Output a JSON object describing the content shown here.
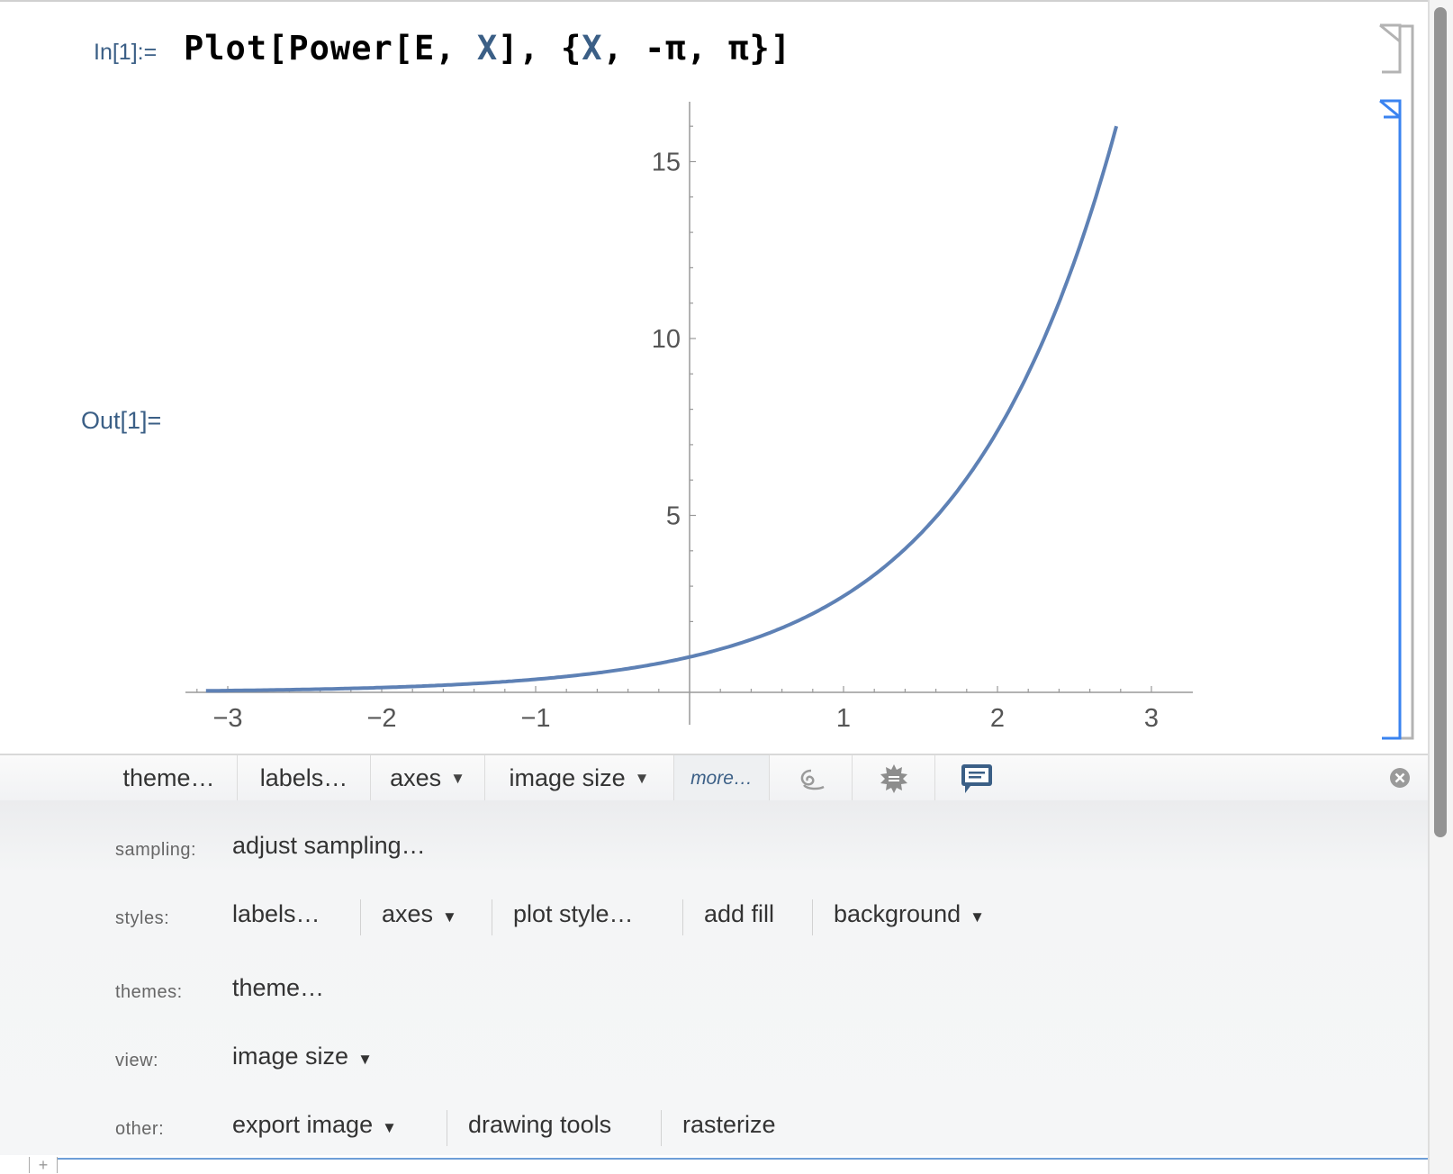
{
  "cell": {
    "in_label": "In[1]:=",
    "code_parts": [
      "Plot[Power[E, ",
      "X",
      "], {",
      "X",
      ", -π, π}]"
    ],
    "out_label": "Out[1]="
  },
  "chart_data": {
    "type": "line",
    "function": "e^x",
    "xlim": [
      -3.14159,
      3.14159
    ],
    "plot_range_y": [
      0,
      16
    ],
    "x_ticks": [
      -3,
      -2,
      -1,
      1,
      2,
      3
    ],
    "x_tick_labels": [
      "−3",
      "−2",
      "−1",
      "1",
      "2",
      "3"
    ],
    "y_ticks": [
      5,
      10,
      15
    ],
    "y_tick_labels": [
      "5",
      "10",
      "15"
    ],
    "line_color": "#5e81b5",
    "grid": false,
    "title": "",
    "xlabel": "",
    "ylabel": ""
  },
  "toolbar": {
    "items": [
      {
        "label": "theme…",
        "dropdown": false
      },
      {
        "label": "labels…",
        "dropdown": false
      },
      {
        "label": "axes",
        "dropdown": true
      },
      {
        "label": "image size",
        "dropdown": true
      },
      {
        "label": "more…",
        "dropdown": false
      }
    ],
    "icons": [
      "spiral-icon",
      "gear-icon",
      "comment-icon"
    ],
    "close_icon": "close-icon",
    "accent": "#3b5f86"
  },
  "panel": {
    "rows": [
      {
        "label": "sampling:",
        "buttons": [
          {
            "label": "adjust sampling…"
          }
        ]
      },
      {
        "label": "styles:",
        "buttons": [
          {
            "label": "labels…"
          },
          {
            "label": "axes",
            "dropdown": true
          },
          {
            "label": "plot style…"
          },
          {
            "label": "add fill"
          },
          {
            "label": "background",
            "dropdown": true
          }
        ]
      },
      {
        "label": "themes:",
        "buttons": [
          {
            "label": "theme…"
          }
        ]
      },
      {
        "label": "view:",
        "buttons": [
          {
            "label": "image size",
            "dropdown": true
          }
        ]
      },
      {
        "label": "other:",
        "buttons": [
          {
            "label": "export image",
            "dropdown": true
          },
          {
            "label": "drawing tools"
          },
          {
            "label": "rasterize"
          }
        ]
      }
    ]
  },
  "insert_cell": "+",
  "dropdown_glyph": "▼"
}
